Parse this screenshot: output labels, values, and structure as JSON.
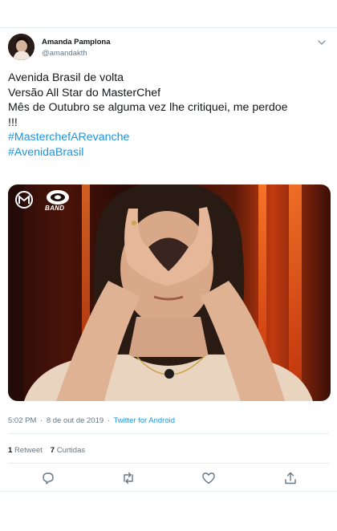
{
  "colors": {
    "text": "#14171a",
    "secondary": "#657786",
    "link": "#1b95e0",
    "divider": "#e6ecf0"
  },
  "author": {
    "display_name": "Amanda Pamplona",
    "handle": "@amandakth"
  },
  "tweet": {
    "lines": [
      "Avenida Brasil de volta",
      "Versão All Star do MasterChef",
      "Mês de Outubro se alguma vez lhe critiquei, me perdoe",
      "!!!"
    ],
    "hashtags": [
      "#MasterchefARevanche",
      "#AvenidaBrasil"
    ]
  },
  "media": {
    "logo_band_text": "BAND",
    "logo_icons": [
      "masterchef-logo-icon",
      "band-logo-icon"
    ]
  },
  "meta": {
    "time": "5:02 PM",
    "separator": "·",
    "date": "8 de out de 2019",
    "source": "Twitter for Android"
  },
  "stats": {
    "retweets_count": "1",
    "retweets_label": "Retweet",
    "likes_count": "7",
    "likes_label": "Curtidas"
  },
  "actions": [
    "reply-icon",
    "retweet-icon",
    "like-icon",
    "share-icon"
  ]
}
